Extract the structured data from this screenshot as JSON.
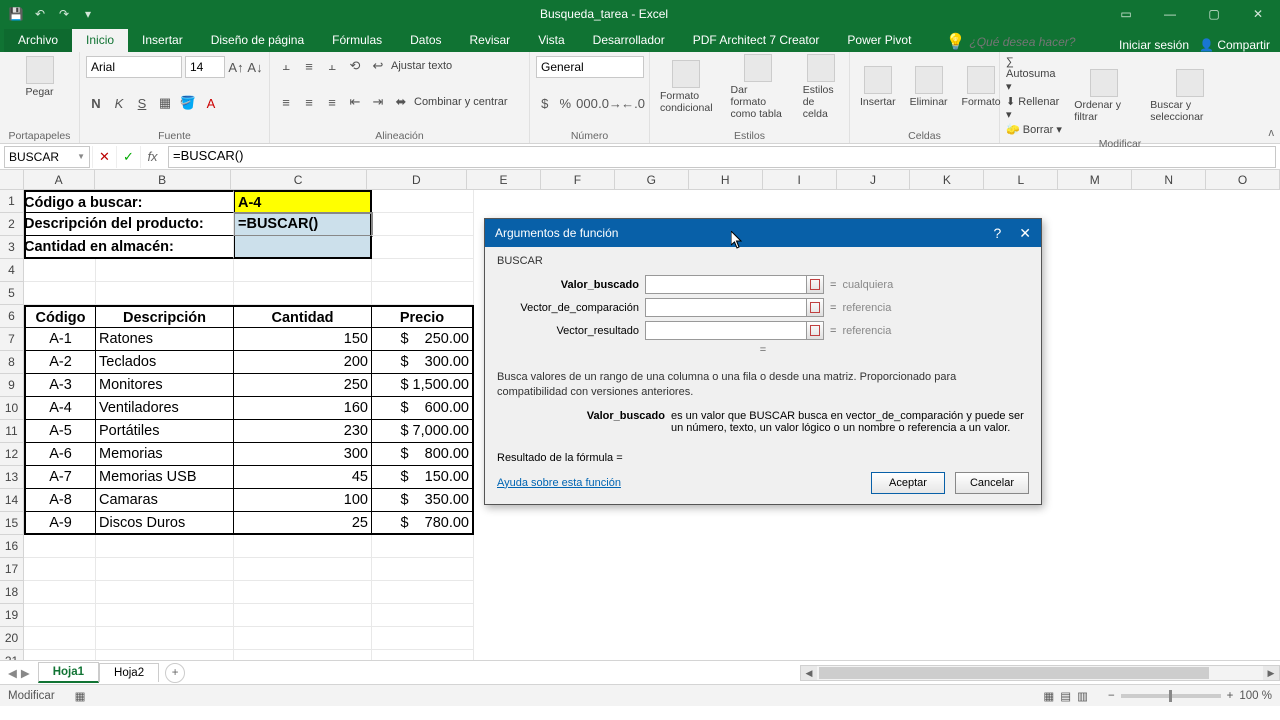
{
  "titlebar": {
    "title": "Busqueda_tarea - Excel"
  },
  "tabs": {
    "file": "Archivo",
    "items": [
      "Inicio",
      "Insertar",
      "Diseño de página",
      "Fórmulas",
      "Datos",
      "Revisar",
      "Vista",
      "Desarrollador",
      "PDF Architect 7 Creator",
      "Power Pivot"
    ],
    "active": "Inicio",
    "tell_placeholder": "¿Qué desea hacer?",
    "signin": "Iniciar sesión",
    "share": "Compartir"
  },
  "ribbon": {
    "clipboard": {
      "paste": "Pegar",
      "label": "Portapapeles"
    },
    "font": {
      "name": "Arial",
      "size": "14",
      "label": "Fuente"
    },
    "align": {
      "wrap": "Ajustar texto",
      "merge": "Combinar y centrar",
      "label": "Alineación"
    },
    "number": {
      "format": "General",
      "label": "Número"
    },
    "styles": {
      "cond": "Formato condicional",
      "table": "Dar formato como tabla",
      "cell": "Estilos de celda",
      "label": "Estilos"
    },
    "cells": {
      "insert": "Insertar",
      "delete": "Eliminar",
      "format": "Formato",
      "label": "Celdas"
    },
    "editing": {
      "sum": "Autosuma",
      "fill": "Rellenar",
      "clear": "Borrar",
      "sort": "Ordenar y filtrar",
      "find": "Buscar y seleccionar",
      "label": "Modificar"
    }
  },
  "formulabar": {
    "name": "BUSCAR",
    "formula": "=BUSCAR()"
  },
  "columns": [
    "A",
    "B",
    "C",
    "D",
    "E",
    "F",
    "G",
    "H",
    "I",
    "J",
    "K",
    "L",
    "M",
    "N",
    "O"
  ],
  "sheet": {
    "r1": {
      "a1": "Código a buscar:",
      "c1": "A-4"
    },
    "r2": {
      "a2": "Descripción del producto:",
      "c2": "=BUSCAR()"
    },
    "r3": {
      "a3": "Cantidad en almacén:"
    },
    "headers": {
      "a": "Código",
      "b": "Descripción",
      "c": "Cantidad",
      "d": "Precio"
    },
    "rows": [
      {
        "code": "A-1",
        "desc": "Ratones",
        "qty": "150",
        "price": "$    250.00"
      },
      {
        "code": "A-2",
        "desc": "Teclados",
        "qty": "200",
        "price": "$    300.00"
      },
      {
        "code": "A-3",
        "desc": "Monitores",
        "qty": "250",
        "price": "$ 1,500.00"
      },
      {
        "code": "A-4",
        "desc": "Ventiladores",
        "qty": "160",
        "price": "$    600.00"
      },
      {
        "code": "A-5",
        "desc": "Portátiles",
        "qty": "230",
        "price": "$ 7,000.00"
      },
      {
        "code": "A-6",
        "desc": "Memorias",
        "qty": "300",
        "price": "$    800.00"
      },
      {
        "code": "A-7",
        "desc": "Memorias USB",
        "qty": "45",
        "price": "$    150.00"
      },
      {
        "code": "A-8",
        "desc": "Camaras",
        "qty": "100",
        "price": "$    350.00"
      },
      {
        "code": "A-9",
        "desc": "Discos Duros",
        "qty": "25",
        "price": "$    780.00"
      }
    ]
  },
  "dialog": {
    "title": "Argumentos de función",
    "fn": "BUSCAR",
    "args": [
      {
        "label": "Valor_buscado",
        "hint": "cualquiera",
        "bold": true
      },
      {
        "label": "Vector_de_comparación",
        "hint": "referencia",
        "bold": false
      },
      {
        "label": "Vector_resultado",
        "hint": "referencia",
        "bold": false
      }
    ],
    "eq_alone": "=",
    "desc": "Busca valores de un rango de una columna o una fila o desde una matriz. Proporcionado para compatibilidad con versiones anteriores.",
    "argdesc_name": "Valor_buscado",
    "argdesc_text": "es un valor que BUSCAR busca en vector_de_comparación y puede ser un número, texto, un valor lógico o un nombre o referencia a un valor.",
    "result": "Resultado de la fórmula =",
    "help": "Ayuda sobre esta función",
    "ok": "Aceptar",
    "cancel": "Cancelar"
  },
  "sheets": {
    "items": [
      "Hoja1",
      "Hoja2"
    ],
    "active": "Hoja1"
  },
  "statusbar": {
    "mode": "Modificar",
    "zoom": "100 %"
  }
}
